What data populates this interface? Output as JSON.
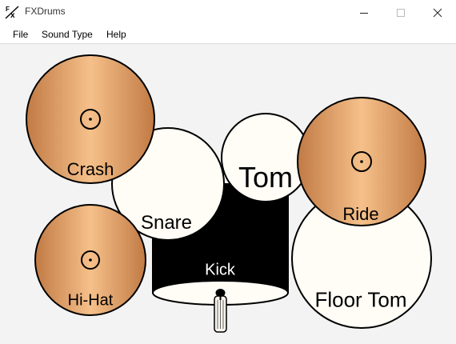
{
  "window": {
    "title": "FXDrums",
    "icon": "fx-app-icon",
    "controls": [
      "minimize-icon",
      "maximize-icon",
      "close-icon"
    ]
  },
  "menu": {
    "items": [
      "File",
      "Sound Type",
      "Help"
    ]
  },
  "kit": {
    "crash": "Crash",
    "snare": "Snare",
    "tom": "Tom",
    "ride": "Ride",
    "hihat": "Hi-Hat",
    "kick": "Kick",
    "floor_tom": "Floor Tom"
  },
  "colors": {
    "cymbal_light": "#f4bd85",
    "cymbal_dark": "#c58049",
    "drum_head": "#fffdf6",
    "kick_shell": "#000000",
    "background": "#f3f3f3"
  }
}
